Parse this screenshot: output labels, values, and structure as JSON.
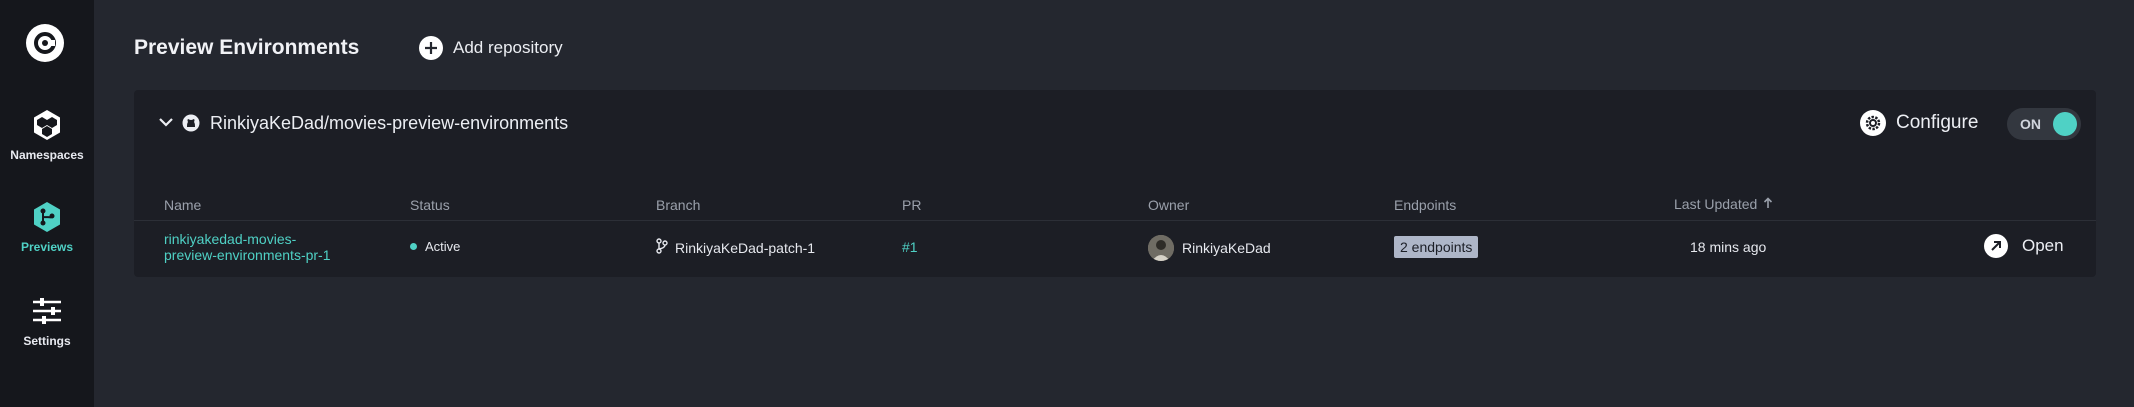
{
  "sidebar": {
    "logo_icon": "brand-logo-icon",
    "items": [
      {
        "label": "Namespaces",
        "icon": "hexagon-cluster-icon"
      },
      {
        "label": "Previews",
        "icon": "preview-branch-icon"
      },
      {
        "label": "Settings",
        "icon": "sliders-icon"
      }
    ],
    "active_color": "#4fd1c5"
  },
  "header": {
    "title": "Preview Environments",
    "add_repository_label": "Add repository"
  },
  "repository": {
    "name": "RinkiyaKeDad/movies-preview-environments",
    "configure_label": "Configure",
    "toggle_label": "ON",
    "toggle_on": true
  },
  "table": {
    "columns": [
      "Name",
      "Status",
      "Branch",
      "PR",
      "Owner",
      "Endpoints",
      "Last Updated"
    ],
    "sort_column": "Last Updated",
    "rows": [
      {
        "name_line1": "rinkiyakedad-movies-",
        "name_line2": "preview-environments-pr-1",
        "status": "Active",
        "branch": "RinkiyaKeDad-patch-1",
        "pr": "#1",
        "owner": "RinkiyaKeDad",
        "endpoints": "2 endpoints",
        "last_updated": "18 mins ago",
        "action": "Open"
      }
    ]
  }
}
